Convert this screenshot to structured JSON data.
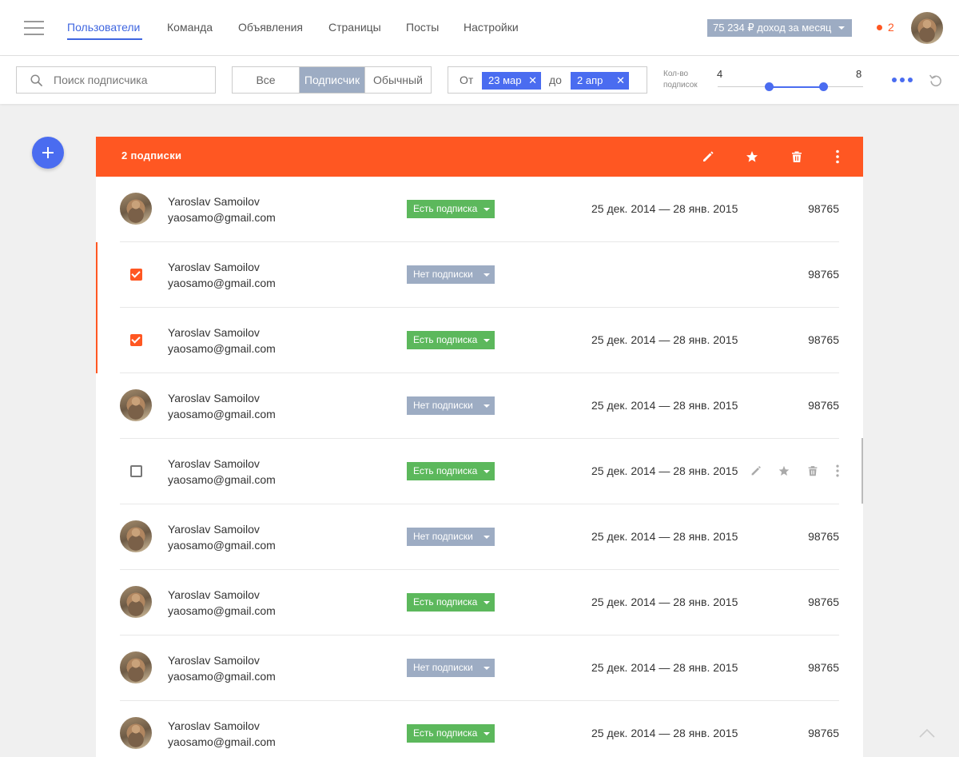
{
  "nav": {
    "items": [
      {
        "label": "Пользователи",
        "active": true
      },
      {
        "label": "Команда"
      },
      {
        "label": "Объявления"
      },
      {
        "label": "Страницы"
      },
      {
        "label": "Посты"
      },
      {
        "label": "Настройки"
      }
    ],
    "income_label": "75 234 ₽ доход за месяц",
    "notifications_count": "2",
    "accent_color": "#3f66e0"
  },
  "filters": {
    "search_placeholder": "Поиск подписчика",
    "segments": [
      "Все",
      "Подписчик",
      "Обычный"
    ],
    "active_segment": "Подписчик",
    "date_from_label": "От",
    "date_from": "23 мар",
    "date_to_label": "до",
    "date_to": "2 апр",
    "count_label_1": "Кол-во",
    "count_label_2": "подписок",
    "range_min": "4",
    "range_max": "8"
  },
  "selection": {
    "count_label": "2 подписки",
    "header_color": "#ff5722",
    "icons": [
      "pencil-icon",
      "star-icon",
      "trash-icon",
      "more-vertical-icon"
    ]
  },
  "rows": [
    {
      "name": "Yaroslav Samoilov",
      "email": "yaosamo@gmail.com",
      "status": "Есть подписка",
      "has_subscription": true,
      "period": "25 дек. 2014 — 28 янв. 2015",
      "number": "98765",
      "lead": "avatar"
    },
    {
      "name": "Yaroslav Samoilov",
      "email": "yaosamo@gmail.com",
      "status": "Нет подписки",
      "has_subscription": false,
      "period": "",
      "number": "98765",
      "lead": "checkbox-checked"
    },
    {
      "name": "Yaroslav Samoilov",
      "email": "yaosamo@gmail.com",
      "status": "Есть подписка",
      "has_subscription": true,
      "period": "25 дек. 2014 — 28 янв. 2015",
      "number": "98765",
      "lead": "checkbox-checked"
    },
    {
      "name": "Yaroslav Samoilov",
      "email": "yaosamo@gmail.com",
      "status": "Нет подписки",
      "has_subscription": false,
      "period": "25 дек. 2014 — 28 янв. 2015",
      "number": "98765",
      "lead": "avatar"
    },
    {
      "name": "Yaroslav Samoilov",
      "email": "yaosamo@gmail.com",
      "status": "Есть подписка",
      "has_subscription": true,
      "period": "25 дек. 2014 — 28 янв. 2015",
      "number": "",
      "lead": "checkbox-unchecked",
      "hover_actions": [
        "pencil-icon",
        "star-icon",
        "trash-icon",
        "more-vertical-icon"
      ]
    },
    {
      "name": "Yaroslav Samoilov",
      "email": "yaosamo@gmail.com",
      "status": "Нет подписки",
      "has_subscription": false,
      "period": "25 дек. 2014 — 28 янв. 2015",
      "number": "98765",
      "lead": "avatar"
    },
    {
      "name": "Yaroslav Samoilov",
      "email": "yaosamo@gmail.com",
      "status": "Есть подписка",
      "has_subscription": true,
      "period": "25 дек. 2014 — 28 янв. 2015",
      "number": "98765",
      "lead": "avatar"
    },
    {
      "name": "Yaroslav Samoilov",
      "email": "yaosamo@gmail.com",
      "status": "Нет подписки",
      "has_subscription": false,
      "period": "25 дек. 2014 — 28 янв. 2015",
      "number": "98765",
      "lead": "avatar"
    },
    {
      "name": "Yaroslav Samoilov",
      "email": "yaosamo@gmail.com",
      "status": "Есть подписка",
      "has_subscription": true,
      "period": "25 дек. 2014 — 28 янв. 2015",
      "number": "98765",
      "lead": "avatar"
    }
  ]
}
